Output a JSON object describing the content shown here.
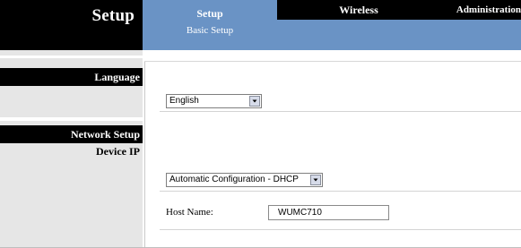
{
  "header": {
    "title": "Setup",
    "tabs": [
      {
        "label": "Setup",
        "active": true
      },
      {
        "label": "Wireless",
        "active": false
      },
      {
        "label": "Administration",
        "active": false
      }
    ],
    "subtab": "Basic Setup"
  },
  "sidebar": {
    "language_label": "Language",
    "network_setup_label": "Network Setup",
    "device_ip_label": "Device IP"
  },
  "main": {
    "language_select": {
      "value": "English"
    },
    "ip_config_select": {
      "value": "Automatic Configuration - DHCP"
    },
    "host_name": {
      "label": "Host Name:",
      "value": "WUMC710"
    }
  },
  "colors": {
    "header_black": "#000000",
    "header_blue": "#6a93c5",
    "sidebar_gray": "#e6e6e6"
  }
}
